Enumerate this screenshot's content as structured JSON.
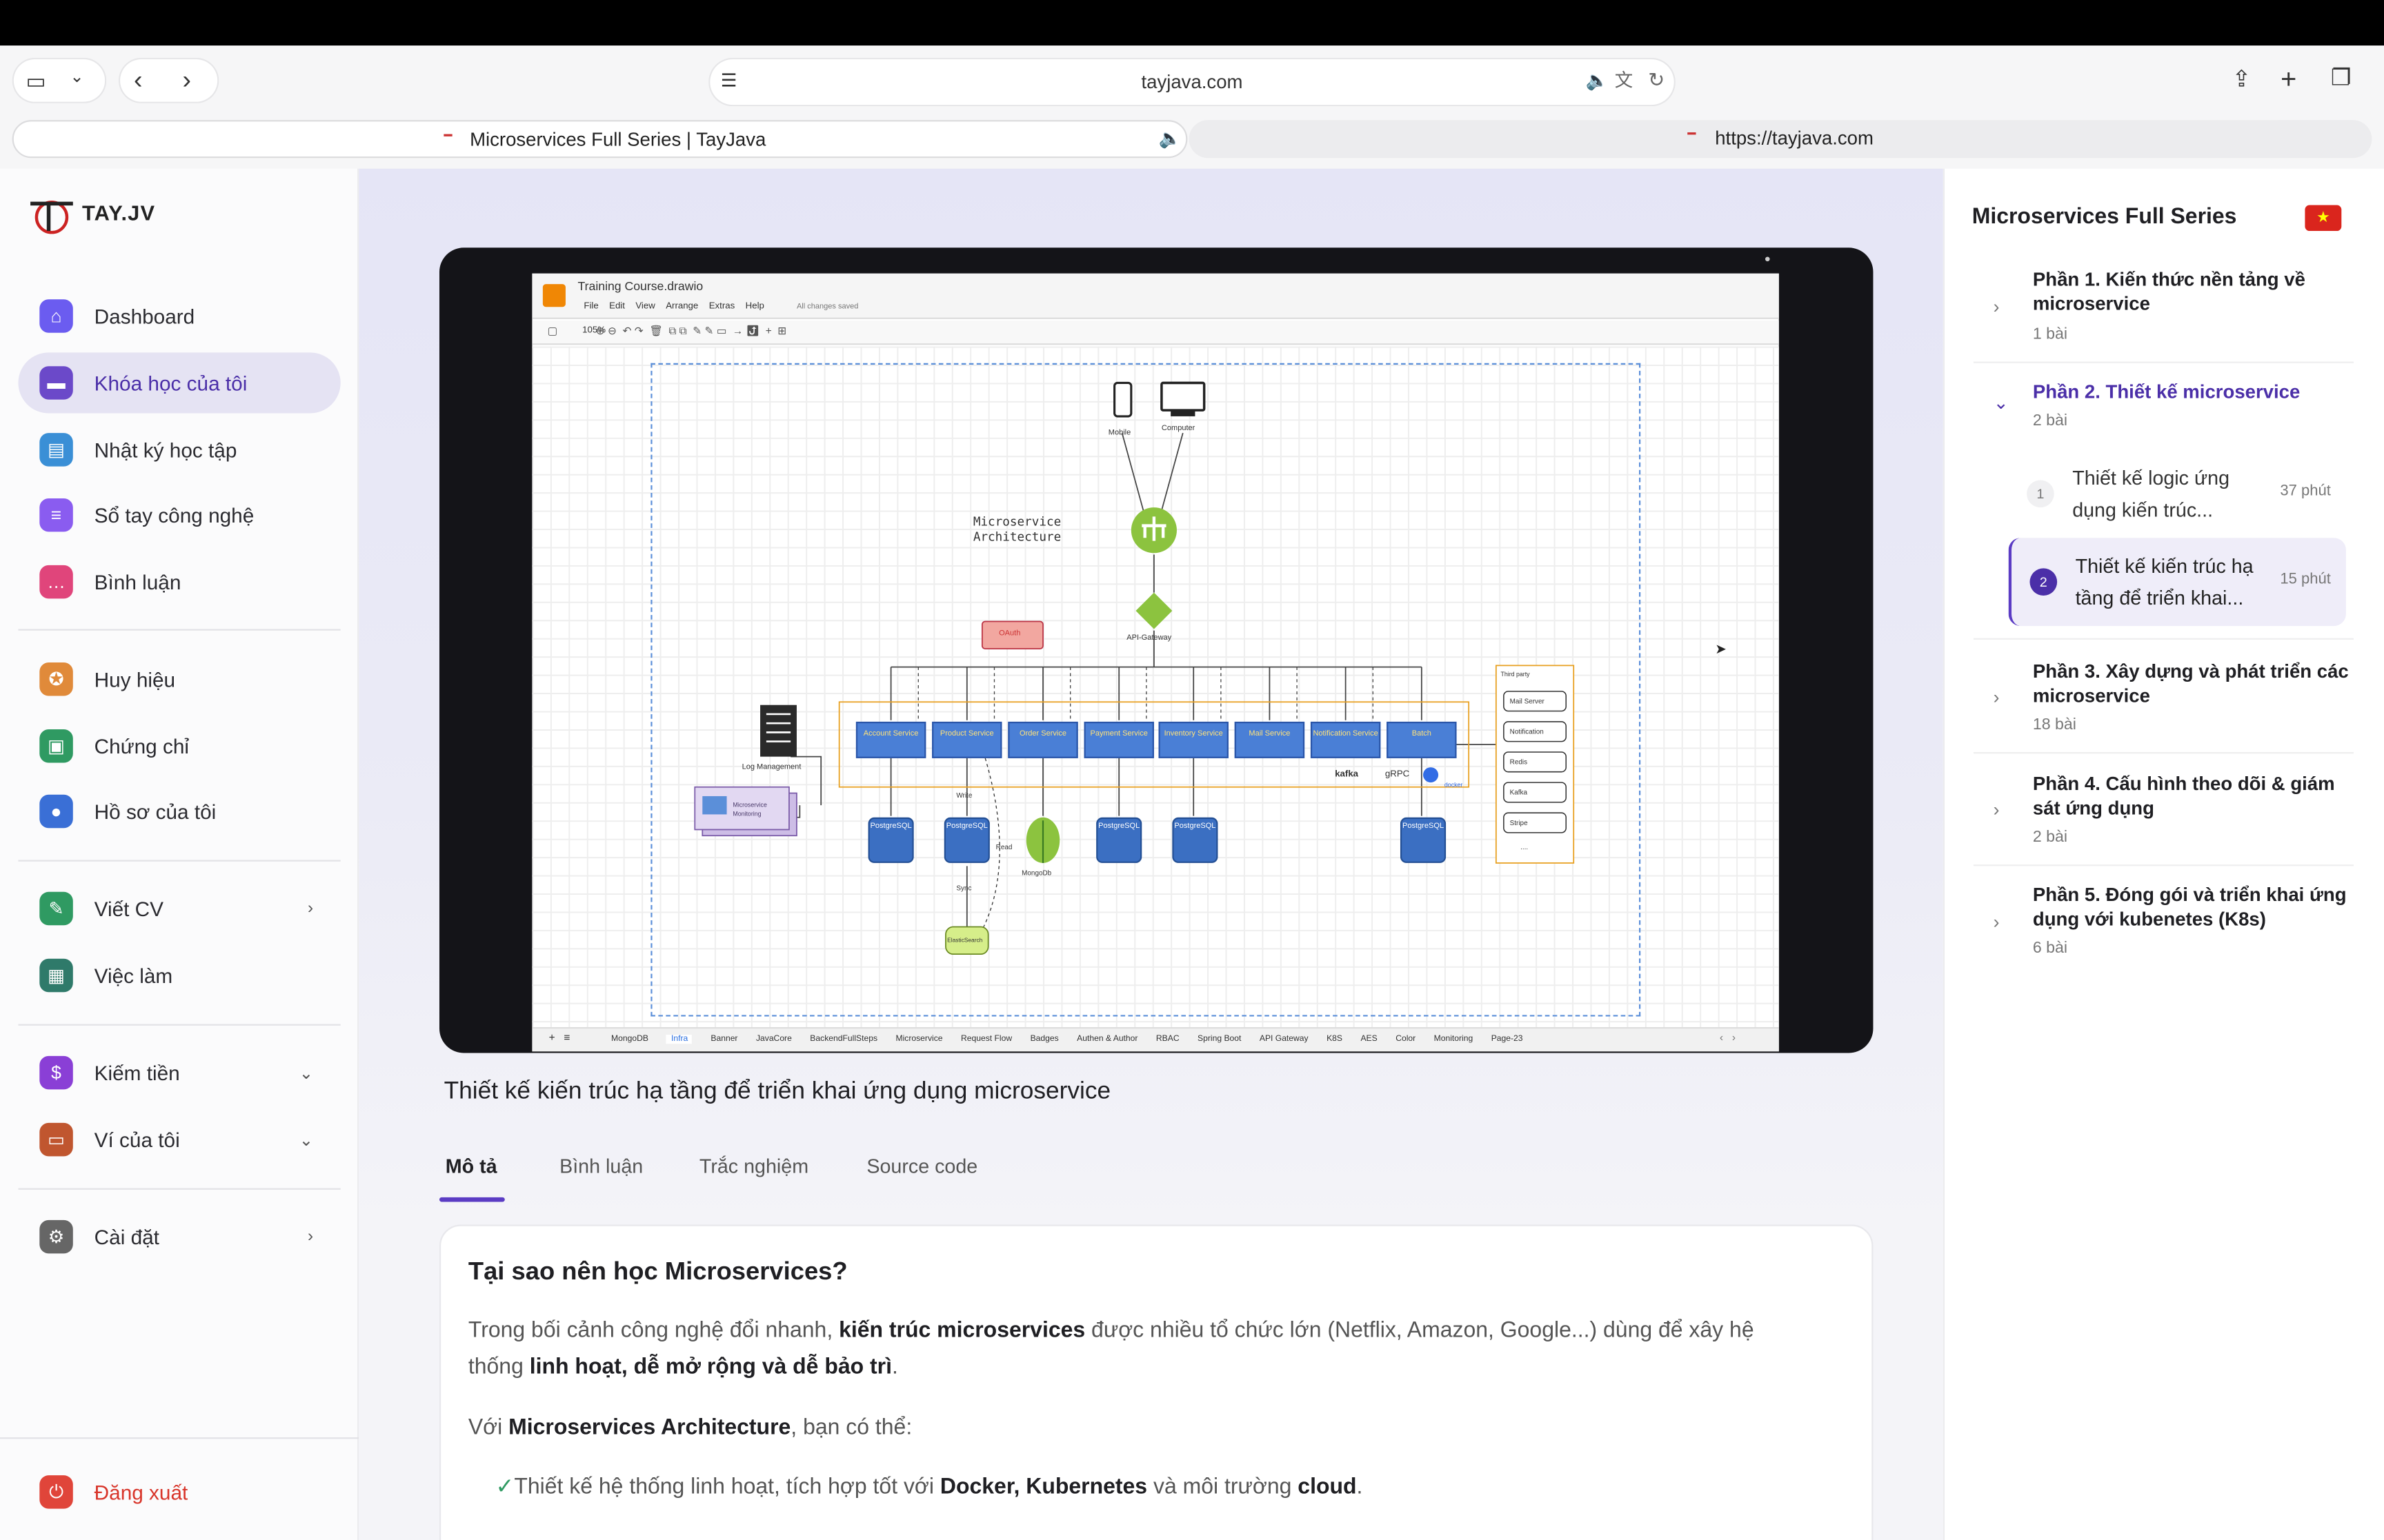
{
  "browser": {
    "url": "tayjava.com",
    "tabs": [
      {
        "title": "Microservices Full Series | TayJava"
      },
      {
        "title": "https://tayjava.com"
      }
    ]
  },
  "sidebar": {
    "logo": "TAY.JV",
    "items": [
      {
        "label": "Dashboard",
        "icon": "home-icon",
        "color": "#6b5cf0"
      },
      {
        "label": "Khóa học của tôi",
        "icon": "monitor-icon",
        "color": "#6b49c9",
        "active": true
      },
      {
        "label": "Nhật ký học tập",
        "icon": "notebook-icon",
        "color": "#3a8fd6"
      },
      {
        "label": "Sổ tay công nghệ",
        "icon": "document-icon",
        "color": "#8a5cf0"
      },
      {
        "label": "Bình luận",
        "icon": "chat-icon",
        "color": "#e0457b"
      },
      {
        "label": "Huy hiệu",
        "icon": "badge-icon",
        "color": "#e08a3a"
      },
      {
        "label": "Chứng chỉ",
        "icon": "certificate-icon",
        "color": "#2f9a62"
      },
      {
        "label": "Hồ sơ của tôi",
        "icon": "user-icon",
        "color": "#3a6fd6"
      },
      {
        "label": "Viết CV",
        "icon": "pen-icon",
        "color": "#2f9a62"
      },
      {
        "label": "Việc làm",
        "icon": "briefcase-icon",
        "color": "#2f7a6a"
      },
      {
        "label": "Kiếm tiền",
        "icon": "money-icon",
        "color": "#8a3fd6"
      },
      {
        "label": "Ví của tôi",
        "icon": "wallet-icon",
        "color": "#c0562f"
      },
      {
        "label": "Cài đặt",
        "icon": "gear-icon",
        "color": "#666"
      }
    ],
    "logout": "Đăng xuất"
  },
  "video": {
    "drawio": {
      "filename": "Training Course.drawio",
      "menu": [
        "File",
        "Edit",
        "View",
        "Arrange",
        "Extras",
        "Help"
      ],
      "saved": "All changes saved",
      "zoom": "105%",
      "diagram_title": "Microservice Architecture",
      "devices": [
        "Mobile",
        "Computer"
      ],
      "gateway": "API-Gateway",
      "oauth": "OAuth",
      "log": "Log Management",
      "monitor": "Microservice Monitoring",
      "services": [
        "Account Service",
        "Product Service",
        "Order Service",
        "Payment Service",
        "Inventory Service",
        "Mail Service",
        "Notification Service",
        "Batch"
      ],
      "dbs": [
        "PostgreSQL",
        "PostgreSQL",
        "MongoDb",
        "PostgreSQL",
        "PostgreSQL",
        "PostgreSQL"
      ],
      "labels": {
        "write": "Write",
        "read": "Read",
        "sync": "Sync",
        "es": "ElasticSearch",
        "mongo": "MongoDb"
      },
      "tech": [
        "kafka",
        "gRPC",
        "docker"
      ],
      "third_party_title": "Third party",
      "third_party": [
        "Mail Server",
        "Notification",
        "Redis",
        "Kafka",
        "Stripe",
        "...."
      ],
      "pages": [
        "MongoDB",
        "Infra",
        "Banner",
        "JavaCore",
        "BackendFullSteps",
        "Microservice",
        "Request Flow",
        "Badges",
        "Authen & Author",
        "RBAC",
        "Spring Boot",
        "API Gateway",
        "K8S",
        "AES",
        "Color",
        "Monitoring",
        "Page-23"
      ]
    }
  },
  "lesson": {
    "title": "Thiết kế kiến trúc hạ tầng để triển khai ứng dụng microservice",
    "tabs": [
      "Mô tả",
      "Bình luận",
      "Trắc nghiệm",
      "Source code"
    ],
    "heading": "Tại sao nên học Microservices?",
    "p1_a": "Trong bối cảnh công nghệ đổi nhanh, ",
    "p1_b": "kiến trúc microservices",
    "p1_c": " được nhiều tổ chức lớn (Netflix, Amazon, Google...) dùng để xây hệ thống ",
    "p1_d": "linh hoạt, dễ mở rộng và dễ bảo trì",
    "p1_e": ".",
    "p2_a": "Với ",
    "p2_b": "Microservices Architecture",
    "p2_c": ", bạn có thể:",
    "b1_a": "Thiết kế hệ thống linh hoạt, tích hợp tốt với ",
    "b1_b": "Docker, Kubernetes",
    "b1_c": " và môi trường ",
    "b1_d": "cloud",
    "b1_e": "."
  },
  "course": {
    "title": "Microservices Full Series",
    "sections": [
      {
        "title": "Phần 1. Kiến thức nền tảng về microservice",
        "count": "1 bài"
      },
      {
        "title": "Phần 2. Thiết kế microservice",
        "count": "2 bài"
      },
      {
        "title": "Phần 3. Xây dựng và phát triển các microservice",
        "count": "18 bài"
      },
      {
        "title": "Phần 4. Cấu hình theo dõi & giám sát ứng dụng",
        "count": "2 bài"
      },
      {
        "title": "Phần 5. Đóng gói và triển khai ứng dụng với kubenetes (K8s)",
        "count": "6 bài"
      }
    ],
    "lessons": [
      {
        "num": "1",
        "title": "Thiết kế logic ứng dụng kiến trúc...",
        "duration": "37 phút"
      },
      {
        "num": "2",
        "title": "Thiết kế kiến trúc hạ tầng để triển khai...",
        "duration": "15 phút"
      }
    ]
  }
}
